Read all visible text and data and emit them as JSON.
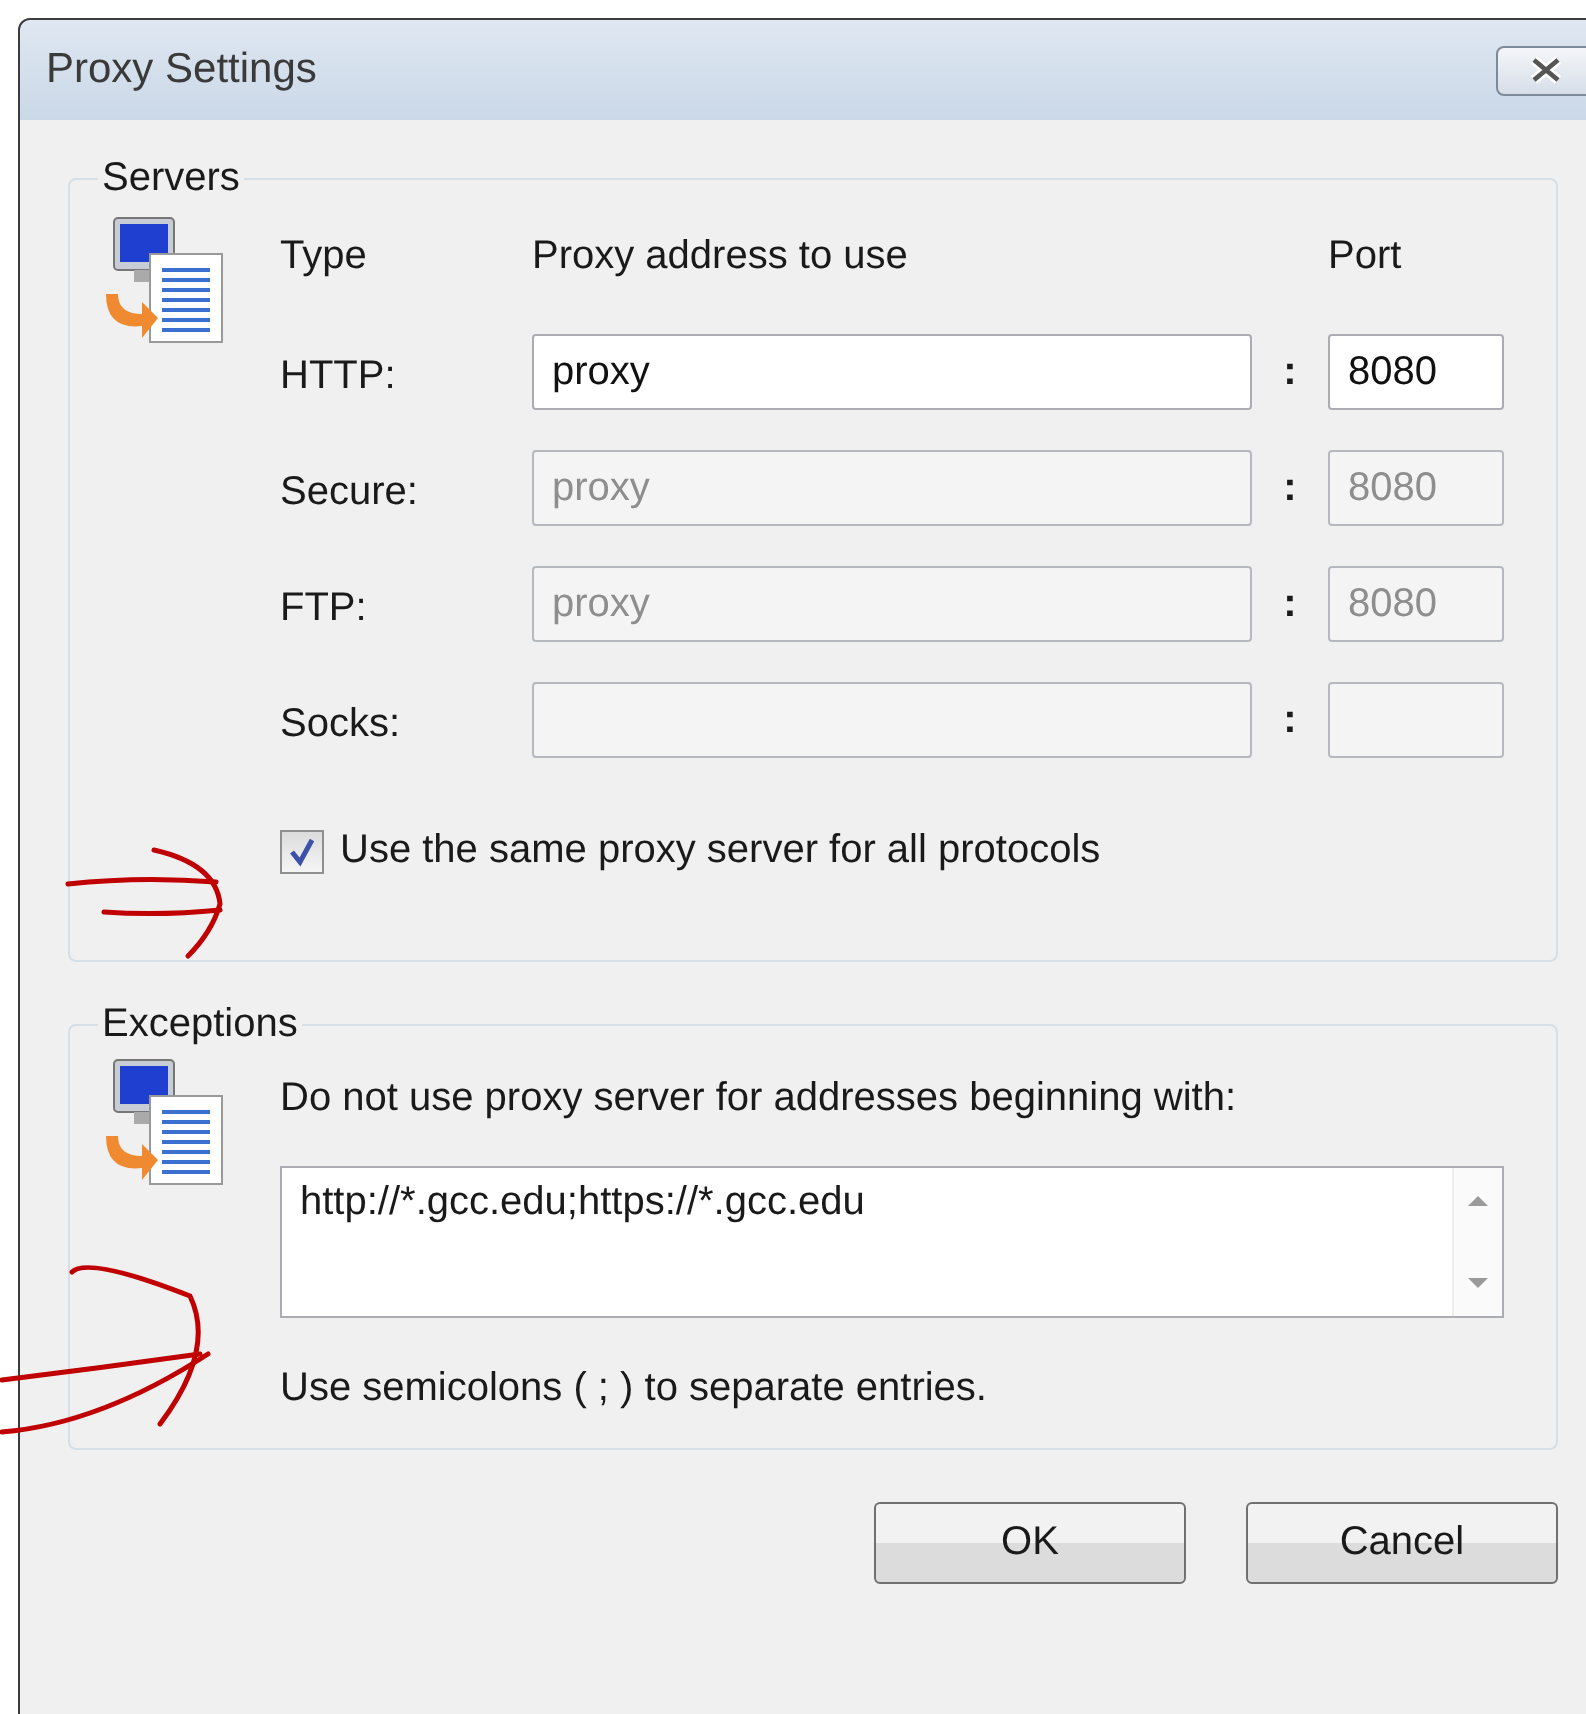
{
  "window": {
    "title": "Proxy Settings"
  },
  "servers": {
    "legend": "Servers",
    "headers": [
      "Type",
      "Proxy address to use",
      "Port"
    ],
    "rows": [
      {
        "label": "HTTP:",
        "address": "proxy",
        "separator": ":",
        "port": "8080",
        "disabled": false
      },
      {
        "label": "Secure:",
        "address": "proxy",
        "separator": ":",
        "port": "8080",
        "disabled": true
      },
      {
        "label": "FTP:",
        "address": "proxy",
        "separator": ":",
        "port": "8080",
        "disabled": true
      },
      {
        "label": "Socks:",
        "separator": ":",
        "disabled": true
      }
    ],
    "same_proxy": {
      "label": "Use the same proxy server for all protocols",
      "checked": true
    }
  },
  "exceptions": {
    "legend": "Exceptions",
    "instruction": "Do not use proxy server for addresses beginning with:",
    "value": "http://*.gcc.edu;https://*.gcc.edu",
    "hint": "Use semicolons ( ; ) to separate entries."
  },
  "buttons": [
    "OK",
    "Cancel"
  ]
}
